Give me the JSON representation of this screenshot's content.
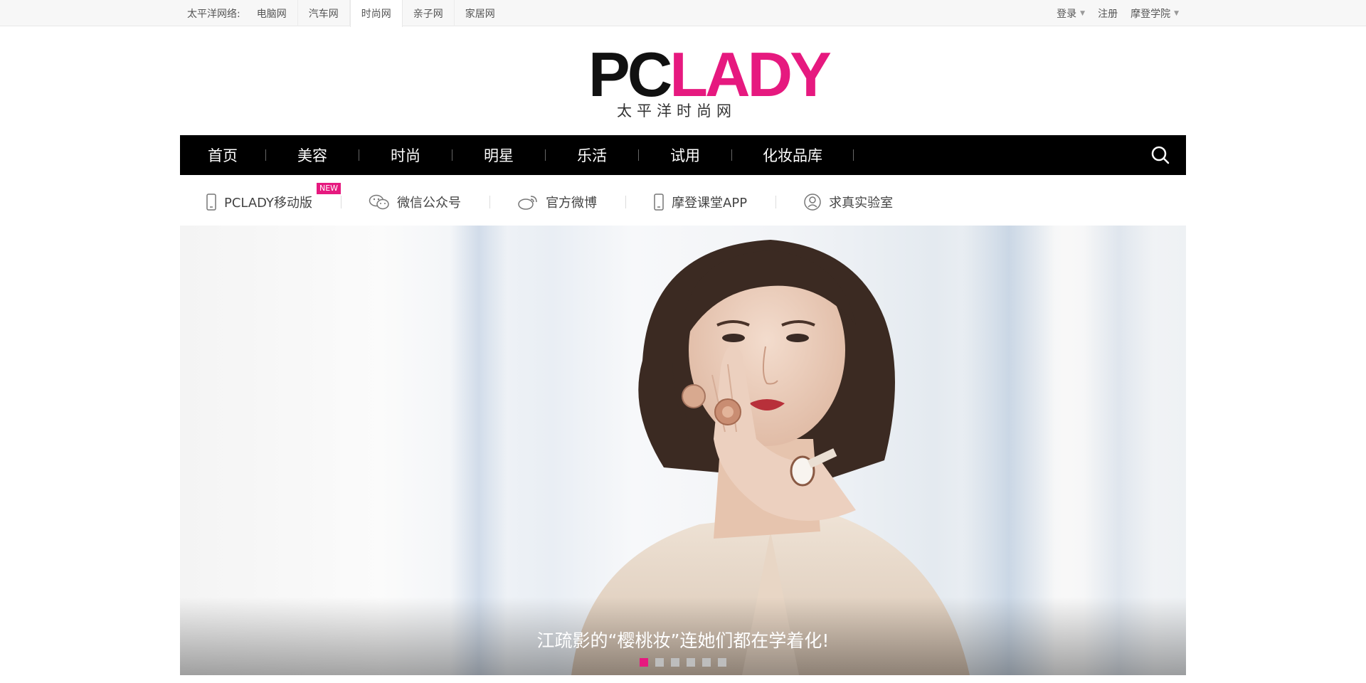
{
  "network_bar": {
    "label": "太平洋网络:",
    "sites": [
      "电脑网",
      "汽车网",
      "时尚网",
      "亲子网",
      "家居网"
    ],
    "active_site": "时尚网"
  },
  "user_links": {
    "login": "登录",
    "register": "注册",
    "academy": "摩登学院"
  },
  "logo": {
    "brand_pc": "PC",
    "brand_lady": "LADY",
    "subtitle": "太平洋时尚网",
    "accent_color": "#e6197f"
  },
  "main_nav": {
    "items": [
      "首页",
      "美容",
      "时尚",
      "明星",
      "乐活",
      "试用",
      "化妆品库"
    ],
    "search_icon": "search-icon"
  },
  "sub_nav": {
    "items": [
      {
        "label": "PCLADY移动版",
        "icon": "mobile-phone-icon",
        "badge": "NEW"
      },
      {
        "label": "微信公众号",
        "icon": "wechat-icon"
      },
      {
        "label": "官方微博",
        "icon": "weibo-icon"
      },
      {
        "label": "摩登课堂APP",
        "icon": "mobile-phone-icon"
      },
      {
        "label": "求真实验室",
        "icon": "lab-icon"
      }
    ]
  },
  "banner": {
    "caption": "江疏影的“樱桃妆”连她们都在学着化!",
    "slide_count": 6,
    "active_slide": 1
  }
}
